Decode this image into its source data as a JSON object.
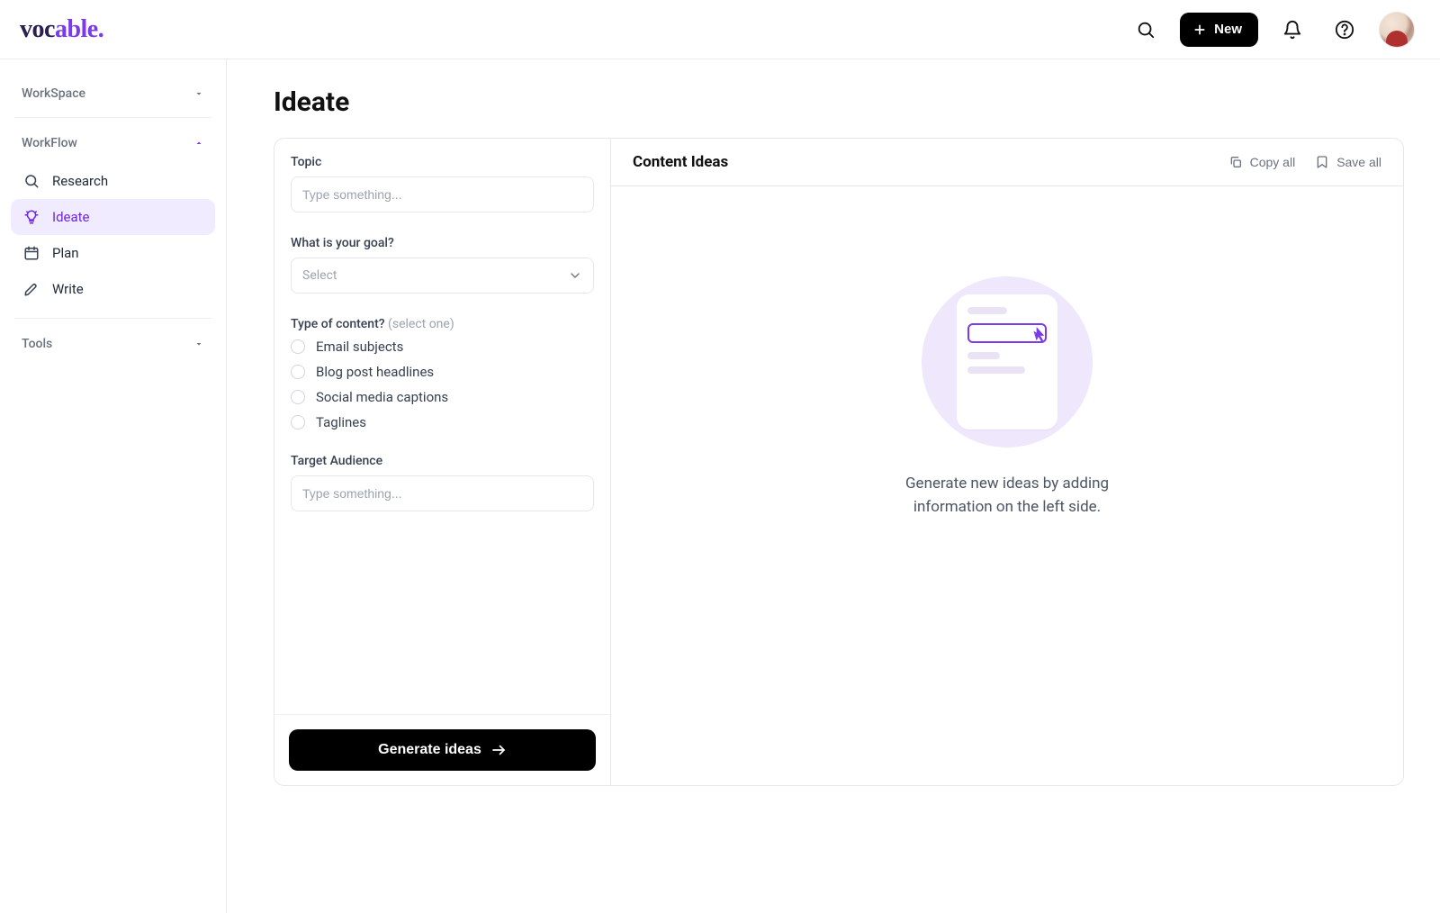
{
  "brand": {
    "part1": "voc",
    "part2": "able",
    "dot": "."
  },
  "header": {
    "new_label": "New"
  },
  "sidebar": {
    "sections": {
      "workspace": "WorkSpace",
      "workflow": "WorkFlow",
      "tools": "Tools"
    },
    "workflow_items": [
      {
        "label": "Research"
      },
      {
        "label": "Ideate"
      },
      {
        "label": "Plan"
      },
      {
        "label": "Write"
      }
    ]
  },
  "page": {
    "title": "Ideate"
  },
  "form": {
    "topic_label": "Topic",
    "topic_placeholder": "Type something...",
    "goal_label": "What is your goal?",
    "goal_placeholder": "Select",
    "content_type_label": "Type of content?",
    "content_type_hint": "(select one)",
    "content_options": [
      "Email subjects",
      "Blog post headlines",
      "Social media captions",
      "Taglines"
    ],
    "audience_label": "Target Audience",
    "audience_placeholder": "Type something...",
    "generate_label": "Generate ideas"
  },
  "results": {
    "title": "Content Ideas",
    "copy_all": "Copy all",
    "save_all": "Save all",
    "empty_line1": "Generate new ideas by adding",
    "empty_line2": "information on the left side."
  }
}
